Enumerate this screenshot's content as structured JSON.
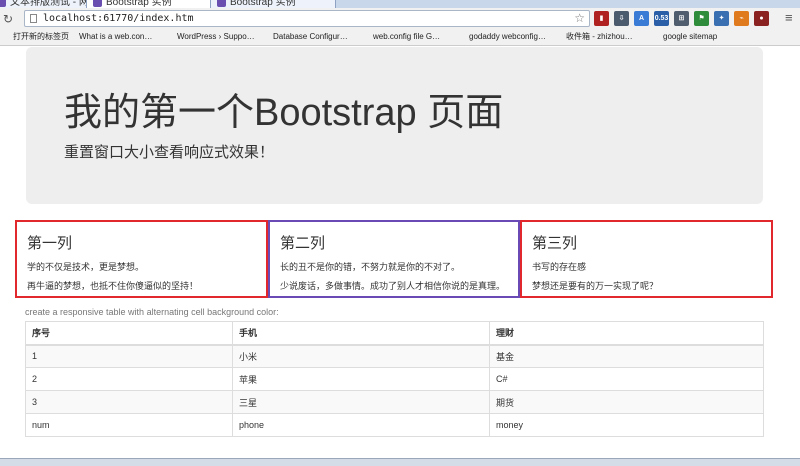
{
  "browser": {
    "tabs": [
      {
        "label": "文本排版测试 - 网站"
      },
      {
        "label": "Bootstrap 实例"
      },
      {
        "label": "Bootstrap 实例"
      }
    ],
    "url": "localhost:61770/index.htm",
    "bookmarks": [
      {
        "label": "打开新的标签页",
        "color": "#e8a33c"
      },
      {
        "label": "What is a web.con…",
        "color": "#d9a23a"
      },
      {
        "label": "WordPress › Suppo…",
        "color": "#3a6ea5"
      },
      {
        "label": "Database Configur…",
        "color": "#2c4a7a"
      },
      {
        "label": "web.config file G…",
        "color": "#2a7ac2"
      },
      {
        "label": "godaddy webconfig…",
        "color": "#3b6fd8"
      },
      {
        "label": "收件箱 - zhizhou…",
        "color": "#c9302c"
      },
      {
        "label": "google sitemap",
        "color": "#4a76b8"
      }
    ],
    "extensions": [
      {
        "icon": "bookmark-ext-icon",
        "color": "#b02222",
        "text": "▮"
      },
      {
        "icon": "download-ext-icon",
        "color": "#4c5a6e",
        "text": "⇩"
      },
      {
        "icon": "translate-ext-icon",
        "color": "#3a7bd5",
        "text": "A"
      },
      {
        "icon": "counter-ext-icon",
        "color": "#2a5fa8",
        "text": "0.53"
      },
      {
        "icon": "delicious-ext-icon",
        "color": "#4f5d6e",
        "text": "⊞"
      },
      {
        "icon": "flag-ext-icon",
        "color": "#2f8c3a",
        "text": "⚑"
      },
      {
        "icon": "puzzle-ext-icon",
        "color": "#3a6fb2",
        "text": "✦"
      },
      {
        "icon": "feed-ext-icon",
        "color": "#e07a1f",
        "text": "⌁"
      },
      {
        "icon": "user-ext-icon",
        "color": "#8b2222",
        "text": "●"
      }
    ]
  },
  "jumbotron": {
    "title": "我的第一个Bootstrap 页面",
    "subtitle": "重置窗口大小查看响应式效果！"
  },
  "columns": [
    {
      "heading": "第一列",
      "line1": "学的不仅是技术，更是梦想。",
      "line2": "再牛逼的梦想，也抵不住你傻逼似的坚持！"
    },
    {
      "heading": "第二列",
      "line1": "长的丑不是你的错，不努力就是你的不对了。",
      "line2": "少说废话，多做事情。成功了别人才相信你说的是真理。"
    },
    {
      "heading": "第三列",
      "line1": "书写的存在感",
      "line2": "梦想还是要有的万一实现了呢？"
    }
  ],
  "table": {
    "caption": "create a responsive table with alternating cell background color:",
    "headers": [
      "序号",
      "手机",
      "理财"
    ],
    "rows": [
      [
        "1",
        "小米",
        "基金"
      ],
      [
        "2",
        "苹果",
        "C#"
      ],
      [
        "3",
        "三星",
        "期货"
      ],
      [
        "num",
        "phone",
        "money"
      ]
    ]
  }
}
